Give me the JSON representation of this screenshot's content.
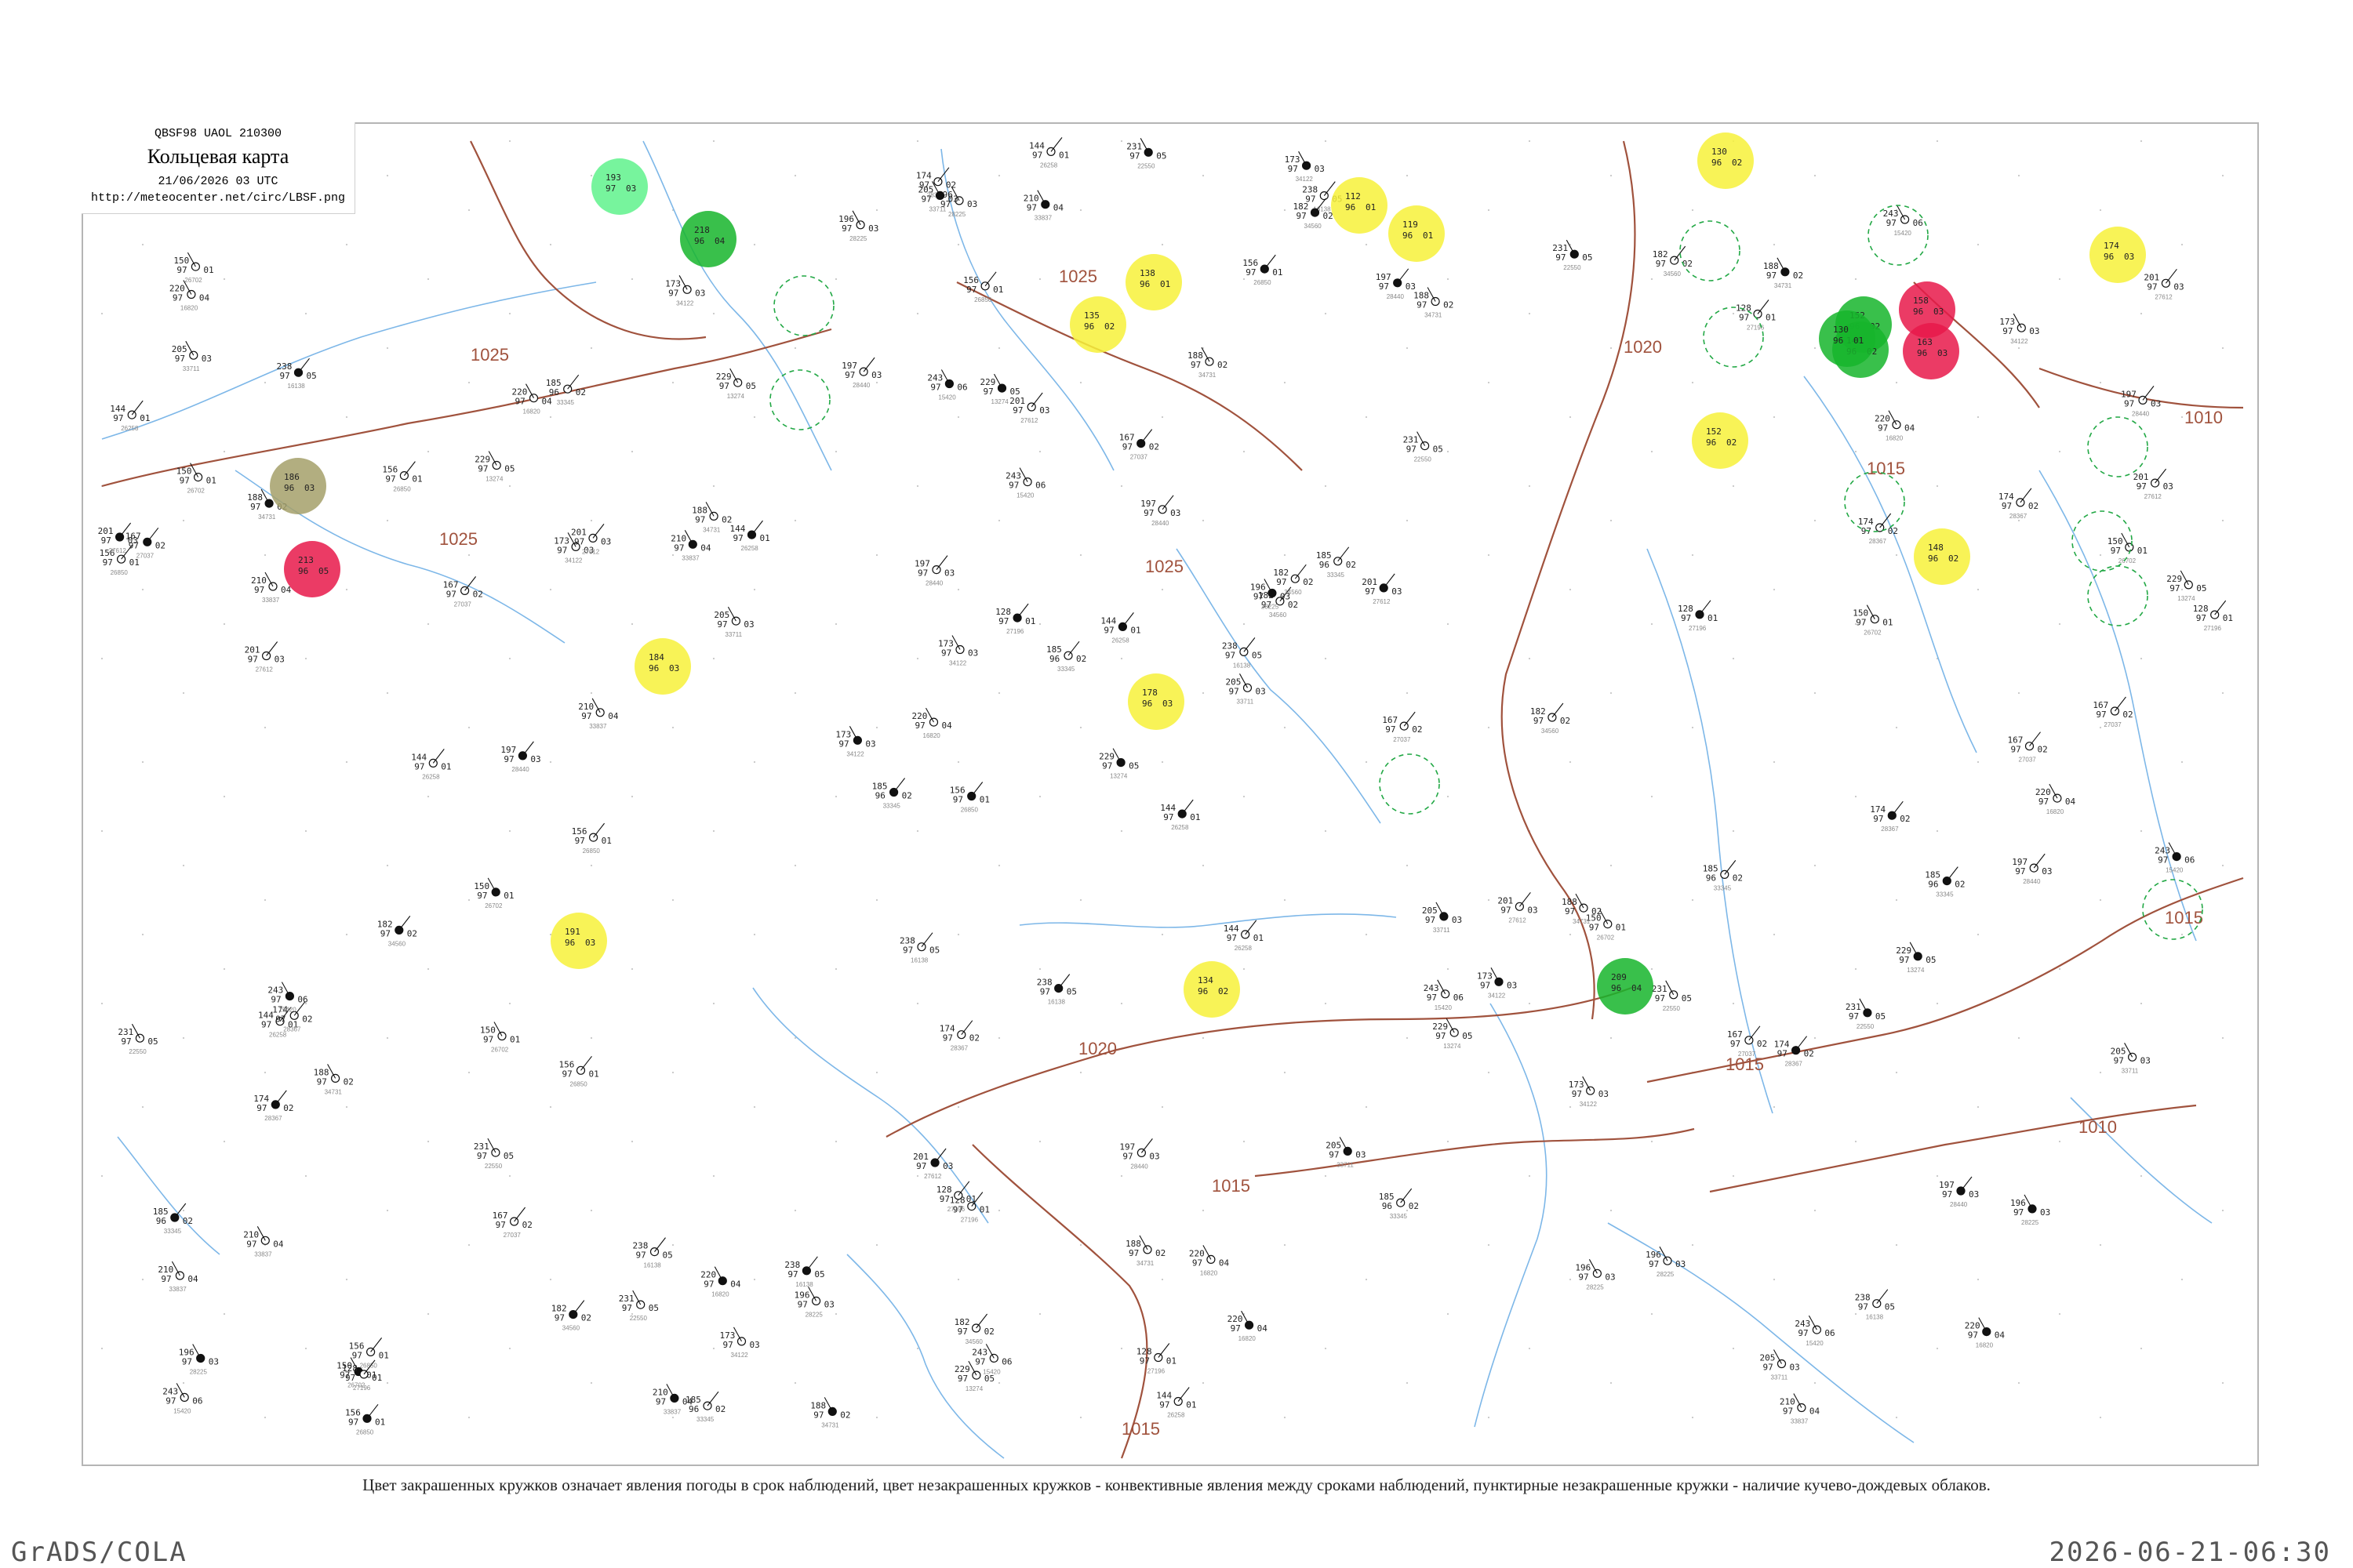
{
  "header": {
    "code": "QBSF98 UAOL 210300",
    "title": "Кольцевая карта",
    "date": "21/06/2026 03 UTC",
    "url": "http://meteocenter.net/circ/LBSF.png"
  },
  "caption": "Цвет закрашенных кружков означает явления погоды в срок наблюдений, цвет незакрашенных кружков - конвективные явления между сроками наблюдений, пунктирные незакрашенные кружки - наличие кучево-дождевых облаков.",
  "footer": {
    "software": "GrADS/COLA",
    "timestamp": "2026-06-21-06:30"
  },
  "isobar_labels": [
    "1025",
    "1025",
    "1025",
    "1025",
    "1020",
    "1020",
    "1015",
    "1015",
    "1015",
    "1015",
    "1010",
    "1010",
    "1015"
  ],
  "colors": {
    "isobar": "#a0523d",
    "water": "#7db7e8",
    "thunder": "#e8194a",
    "rain": "#16b52c",
    "shower": "#f7f13a",
    "haze": "#a5a06a",
    "fog_light": "#5ff28c",
    "cb_dashed": "#22a845"
  },
  "stations": [
    {
      "t": "220",
      "p": "97",
      "dp": "04",
      "n": "16820"
    },
    {
      "t": "201",
      "p": "97",
      "dp": "03",
      "n": "27612"
    },
    {
      "t": "173",
      "p": "97",
      "dp": "03",
      "n": "34122"
    },
    {
      "t": "185",
      "p": "96",
      "dp": "02",
      "n": "33345"
    },
    {
      "t": "231",
      "p": "97",
      "dp": "05",
      "n": "22550"
    },
    {
      "t": "156",
      "p": "97",
      "dp": "01",
      "n": "26850"
    },
    {
      "t": "243",
      "p": "97",
      "dp": "06",
      "n": "15420"
    },
    {
      "t": "197",
      "p": "97",
      "dp": "03",
      "n": "28440"
    },
    {
      "t": "188",
      "p": "97",
      "dp": "02",
      "n": "34731"
    },
    {
      "t": "144",
      "p": "97",
      "dp": "01",
      "n": "26258"
    },
    {
      "t": "210",
      "p": "97",
      "dp": "04",
      "n": "33837"
    },
    {
      "t": "167",
      "p": "97",
      "dp": "02",
      "n": "27037"
    },
    {
      "t": "229",
      "p": "97",
      "dp": "05",
      "n": "13274"
    },
    {
      "t": "182",
      "p": "97",
      "dp": "02",
      "n": "34560"
    },
    {
      "t": "150",
      "p": "97",
      "dp": "01",
      "n": "26702"
    },
    {
      "t": "238",
      "p": "97",
      "dp": "05",
      "n": "16138"
    },
    {
      "t": "196",
      "p": "97",
      "dp": "03",
      "n": "28225"
    },
    {
      "t": "128",
      "p": "97",
      "dp": "01",
      "n": "27196"
    },
    {
      "t": "205",
      "p": "97",
      "dp": "03",
      "n": "33711"
    },
    {
      "t": "174",
      "p": "97",
      "dp": "02",
      "n": "28367"
    }
  ],
  "weather_circles": [
    {
      "kind": "thunder",
      "t": "213",
      "p": "96",
      "dp": "05"
    },
    {
      "kind": "thunder",
      "t": "158",
      "p": "96",
      "dp": "03"
    },
    {
      "kind": "thunder",
      "t": "163",
      "p": "96",
      "dp": "03"
    },
    {
      "kind": "rain",
      "t": "218",
      "p": "96",
      "dp": "04"
    },
    {
      "kind": "rain",
      "t": "152",
      "p": "96",
      "dp": "02"
    },
    {
      "kind": "rain",
      "t": "140",
      "p": "96",
      "dp": "02"
    },
    {
      "kind": "rain",
      "t": "130",
      "p": "96",
      "dp": "01"
    },
    {
      "kind": "rain",
      "t": "209",
      "p": "96",
      "dp": "04"
    },
    {
      "kind": "fog_light",
      "t": "193",
      "p": "97",
      "dp": "03"
    },
    {
      "kind": "haze",
      "t": "186",
      "p": "96",
      "dp": "03"
    },
    {
      "kind": "shower",
      "t": "138",
      "p": "96",
      "dp": "01"
    },
    {
      "kind": "shower",
      "t": "135",
      "p": "96",
      "dp": "02"
    },
    {
      "kind": "shower",
      "t": "178",
      "p": "96",
      "dp": "03"
    },
    {
      "kind": "shower",
      "t": "184",
      "p": "96",
      "dp": "03"
    },
    {
      "kind": "shower",
      "t": "191",
      "p": "96",
      "dp": "03"
    },
    {
      "kind": "shower",
      "t": "134",
      "p": "96",
      "dp": "02"
    },
    {
      "kind": "shower",
      "t": "112",
      "p": "96",
      "dp": "01"
    },
    {
      "kind": "shower",
      "t": "119",
      "p": "96",
      "dp": "01"
    },
    {
      "kind": "shower",
      "t": "130",
      "p": "96",
      "dp": "02"
    },
    {
      "kind": "shower",
      "t": "148",
      "p": "96",
      "dp": "02"
    },
    {
      "kind": "shower",
      "t": "152",
      "p": "96",
      "dp": "02"
    },
    {
      "kind": "shower",
      "t": "174",
      "p": "96",
      "dp": "03"
    }
  ]
}
